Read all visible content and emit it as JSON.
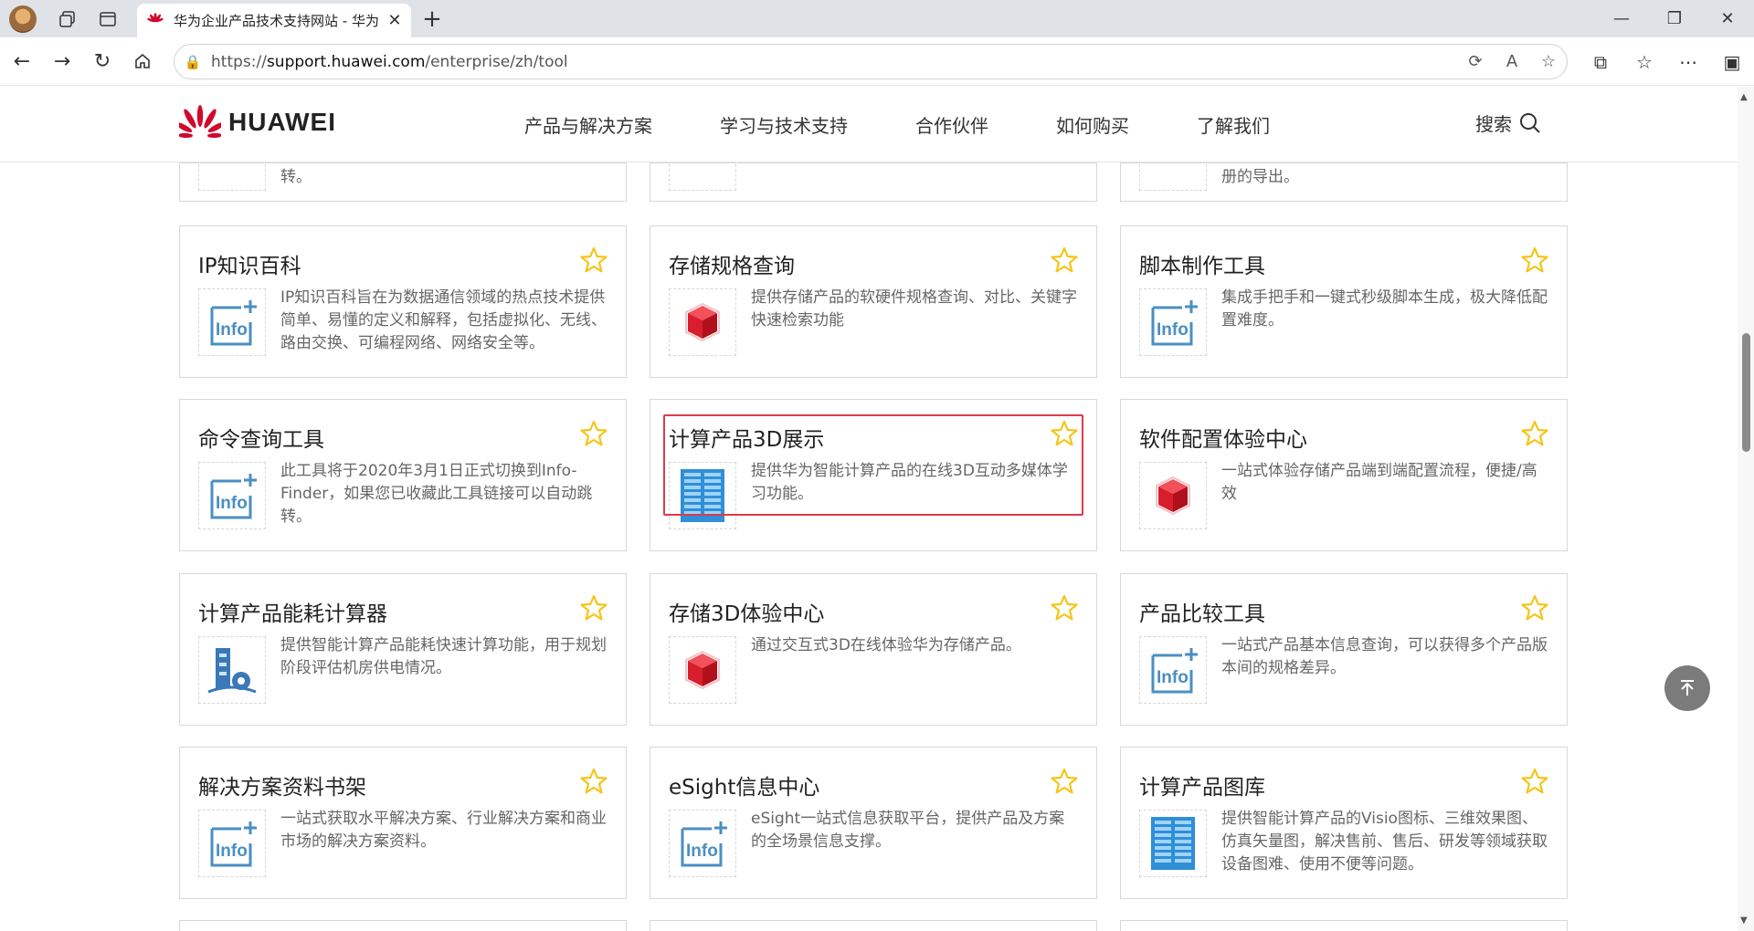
{
  "browser": {
    "tab_title": "华为企业产品技术支持网站 - 华为",
    "url_prefix": "https://",
    "url_host": "support.huawei.com",
    "url_path": "/enterprise/zh/tool"
  },
  "header": {
    "logo_text": "HUAWEI",
    "nav": [
      "产品与解决方案",
      "学习与技术支持",
      "合作伙伴",
      "如何购买",
      "了解我们"
    ],
    "search_label": "搜索"
  },
  "partial_row": {
    "col1_text": "转。",
    "col3_text": "册的导出。"
  },
  "cards": [
    {
      "title": "IP知识百科",
      "desc": "IP知识百科旨在为数据通信领域的热点技术提供简单、易懂的定义和解释，包括虚拟化、无线、路由交换、可编程网络、网络安全等。",
      "icon": "info-icon"
    },
    {
      "title": "存储规格查询",
      "desc": "提供存储产品的软硬件规格查询、对比、关键字快速检索功能",
      "icon": "cube-icon"
    },
    {
      "title": "脚本制作工具",
      "desc": "集成手把手和一键式秒级脚本生成，极大降低配置难度。",
      "icon": "info-icon"
    },
    {
      "title": "命令查询工具",
      "desc": "此工具将于2020年3月1日正式切换到Info-Finder，如果您已收藏此工具链接可以自动跳转。",
      "icon": "info-icon"
    },
    {
      "title": "计算产品3D展示",
      "desc": "提供华为智能计算产品的在线3D互动多媒体学习功能。",
      "icon": "server-icon"
    },
    {
      "title": "软件配置体验中心",
      "desc": "一站式体验存储产品端到端配置流程，便捷/高效",
      "icon": "cube-icon"
    },
    {
      "title": "计算产品能耗计算器",
      "desc": "提供智能计算产品能耗快速计算功能，用于规划阶段评估机房供电情况。",
      "icon": "building-gear-icon"
    },
    {
      "title": "存储3D体验中心",
      "desc": "通过交互式3D在线体验华为存储产品。",
      "icon": "cube-icon"
    },
    {
      "title": "产品比较工具",
      "desc": "一站式产品基本信息查询，可以获得多个产品版本间的规格差异。",
      "icon": "info-icon"
    },
    {
      "title": "解决方案资料书架",
      "desc": "一站式获取水平解决方案、行业解决方案和商业市场的解决方案资料。",
      "icon": "info-icon"
    },
    {
      "title": "eSight信息中心",
      "desc": "eSight一站式信息获取平台，提供产品及方案的全场景信息支撑。",
      "icon": "info-icon"
    },
    {
      "title": "计算产品图库",
      "desc": "提供智能计算产品的Visio图标、三维效果图、仿真矢量图，解决售前、售后、研发等领域获取设备图难、使用不便等问题。",
      "icon": "server-icon"
    }
  ],
  "colors": {
    "brand_red": "#cf0a2c",
    "star_yellow": "#f5c518",
    "highlight_red": "#e0394a",
    "icon_blue": "#4a8fc2"
  }
}
